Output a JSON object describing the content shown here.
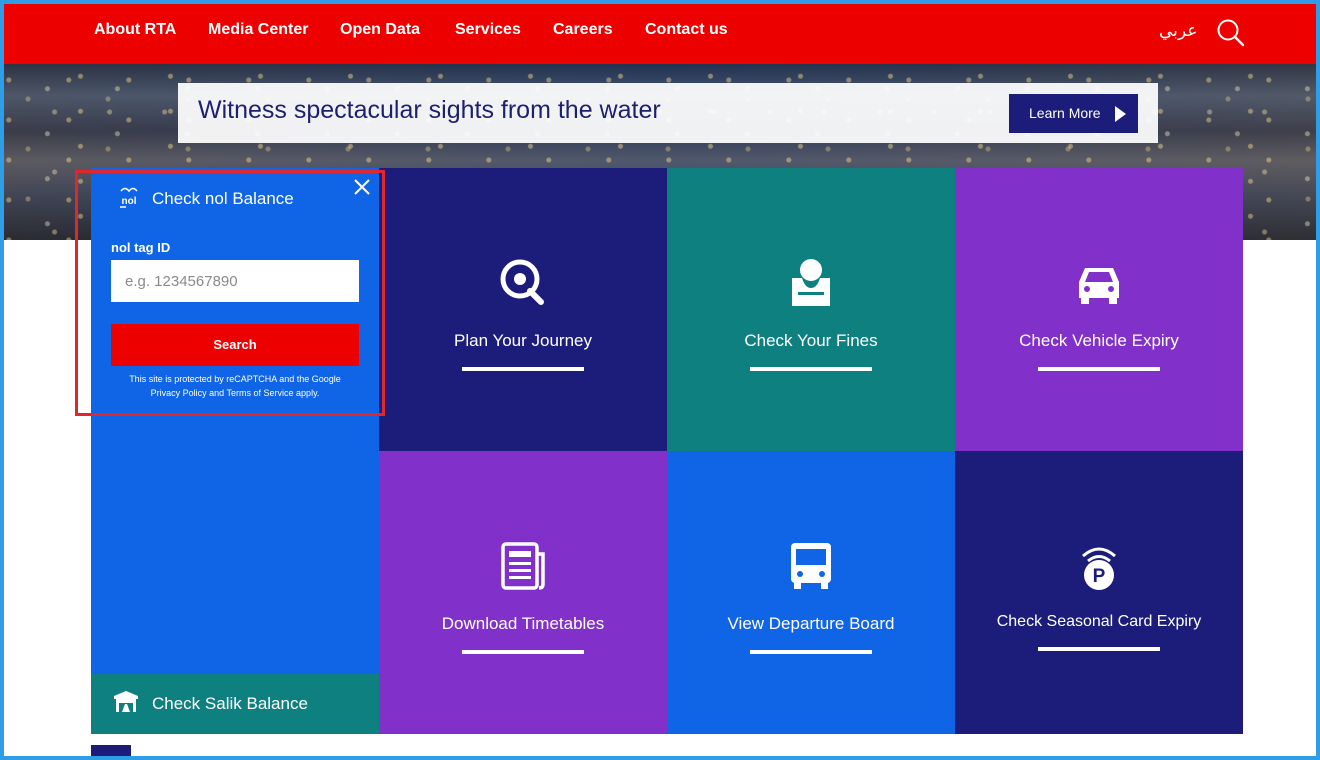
{
  "nav": {
    "items": [
      "About RTA",
      "Media Center",
      "Open Data",
      "Services",
      "Careers",
      "Contact us"
    ],
    "language": "عربي",
    "search_icon": "search-icon",
    "color": "#ec0000"
  },
  "promo": {
    "text": "Witness spectacular sights from the water",
    "button_label": "Learn More"
  },
  "nol": {
    "logo": "nol",
    "title": "Check nol Balance",
    "field_label": "nol tag ID",
    "placeholder": "e.g. 1234567890",
    "button_label": "Search",
    "captcha_prefix": "This site is protected by reCAPTCHA and the Google",
    "privacy_link": "Privacy Policy",
    "and_text": "and",
    "terms_link": "Terms of Service",
    "suffix": "apply.",
    "color": "#1064e6"
  },
  "salik": {
    "label": "Check Salik Balance",
    "icon": "toll-gate-icon"
  },
  "tiles": [
    {
      "label": "Plan Your Journey",
      "icon": "map-pin-icon",
      "color": "#1c1d7a"
    },
    {
      "label": "Check Your Fines",
      "icon": "officer-icon",
      "color": "#0f8080"
    },
    {
      "label": "Check Vehicle Expiry",
      "icon": "car-icon",
      "color": "#8131c9"
    },
    {
      "label": "Download Timetables",
      "icon": "newspaper-icon",
      "color": "#8131c9"
    },
    {
      "label": "View Departure Board",
      "icon": "bus-icon",
      "color": "#1064e6"
    },
    {
      "label": "Check Seasonal Card Expiry",
      "icon": "parking-icon",
      "color": "#1c1d7a"
    }
  ]
}
